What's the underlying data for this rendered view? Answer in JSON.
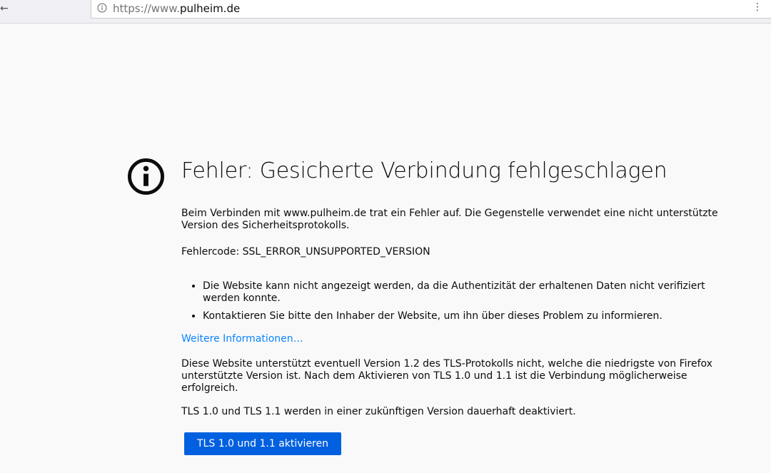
{
  "toolbar": {
    "back_glyph": "←",
    "url_scheme": "https://www.",
    "url_host": "pulheim.de",
    "menu_glyph": "⋮"
  },
  "error": {
    "title": "Fehler: Gesicherte Verbindung fehlgeschlagen",
    "intro": "Beim Verbinden mit www.pulheim.de trat ein Fehler auf. Die Gegenstelle verwendet eine nicht unterstützte Version des Sicherheitsprotokolls.",
    "code": "Fehlercode: SSL_ERROR_UNSUPPORTED_VERSION",
    "bullets": [
      "Die Website kann nicht angezeigt werden, da die Authentizität der erhaltenen Daten nicht verifiziert werden konnte.",
      "Kontaktieren Sie bitte den Inhaber der Website, um ihn über dieses Problem zu informieren."
    ],
    "more_link": "Weitere Informationen…",
    "tls_note_1": "Diese Website unterstützt eventuell Version 1.2 des TLS-Protokolls nicht, welche die niedrigste von Firefox unterstützte Version ist. Nach dem Aktivieren von TLS 1.0 und 1.1 ist die Verbindung möglicherweise erfolgreich.",
    "tls_note_2": "TLS 1.0 und TLS 1.1 werden in einer zukünftigen Version dauerhaft deaktiviert.",
    "enable_button": "TLS 1.0 und 1.1 aktivieren"
  },
  "icons": {
    "url_info": "info-circle-icon",
    "error": "info-circle-icon"
  },
  "colors": {
    "background": "#f9f9fa",
    "link": "#0a84ff",
    "button": "#0060df"
  }
}
